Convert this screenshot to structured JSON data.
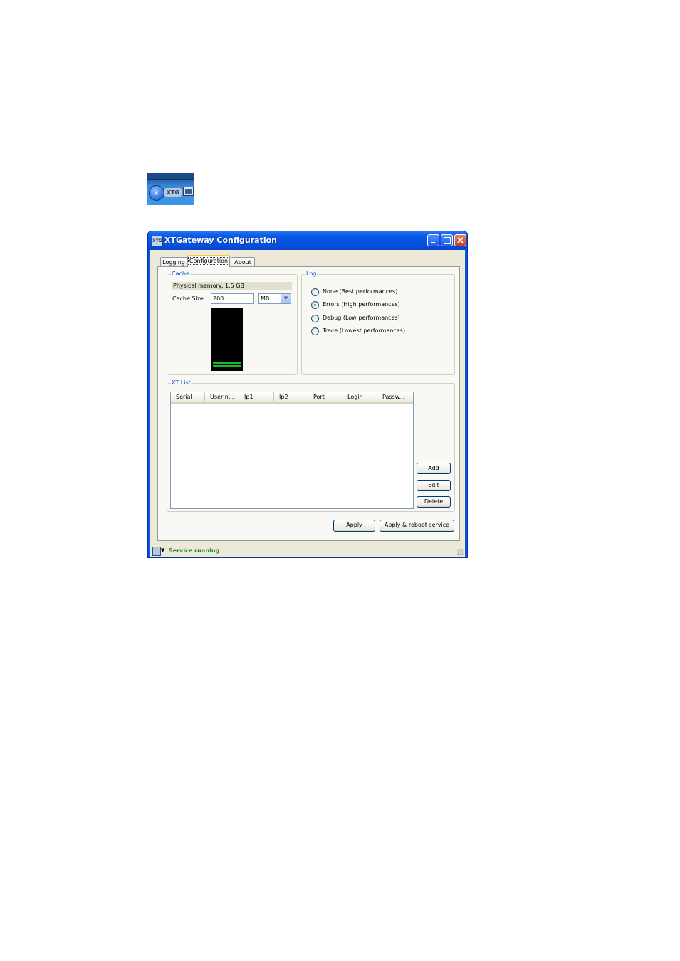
{
  "tray": {
    "back_icon": "back-arrow-icon",
    "app_badge": "XTG",
    "monitor_icon": "monitor-icon"
  },
  "window": {
    "title": "XTGateway Configuration",
    "title_icon_text": "XTG",
    "controls": [
      "minimize",
      "maximize",
      "close"
    ]
  },
  "tabs": [
    {
      "label": "Logging",
      "active": false
    },
    {
      "label": "Configuration",
      "active": true
    },
    {
      "label": "About",
      "active": false
    }
  ],
  "cache": {
    "title": "Cache",
    "physical_memory_label": "Physical memory:",
    "physical_memory_value": "1,5 GB",
    "cache_size_label": "Cache Size:",
    "cache_size_value": "200",
    "unit": "MB"
  },
  "log": {
    "title": "Log",
    "options": [
      {
        "label": "None (Best performances)",
        "selected": false
      },
      {
        "label": "Errors (High performances)",
        "selected": true
      },
      {
        "label": "Debug (Low performances)",
        "selected": false
      },
      {
        "label": "Trace (Lowest performances)",
        "selected": false
      }
    ]
  },
  "xt_list": {
    "title": "XT List",
    "columns": [
      "Serial",
      "User n...",
      "Ip1",
      "Ip2",
      "Port",
      "Login",
      "Passw..."
    ],
    "rows": [],
    "add_label": "Add",
    "edit_label": "Edit",
    "delete_label": "Delete"
  },
  "actions": {
    "apply_label": "Apply",
    "apply_reboot_label": "Apply & reboot service"
  },
  "status": {
    "text": "Service running",
    "color": "#1b8f1b"
  },
  "colors": {
    "titlebar": "#0a5ae6",
    "group_title": "#0046d5",
    "cache_fill": "#18b82b"
  }
}
